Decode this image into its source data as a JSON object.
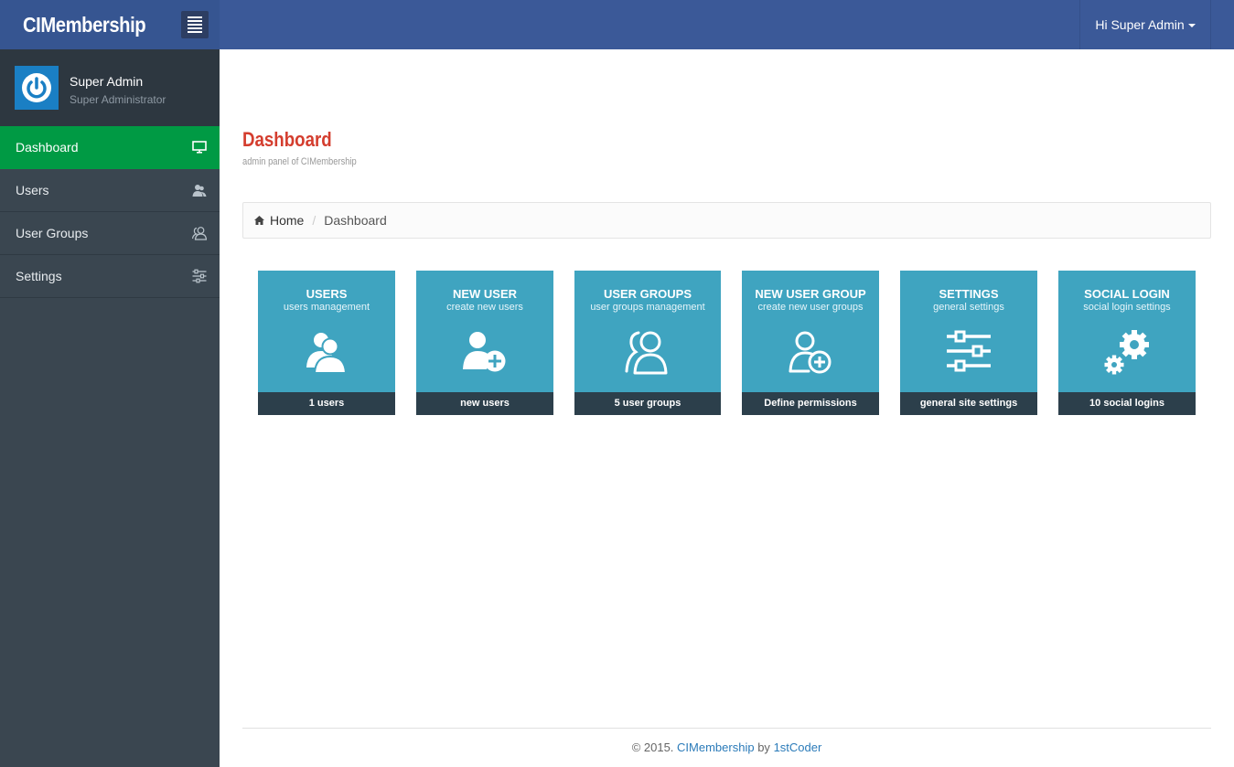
{
  "app": {
    "brand": "CIMembership"
  },
  "header": {
    "user_greeting": "Hi Super Admin"
  },
  "profile": {
    "name": "Super Admin",
    "role": "Super Administrator"
  },
  "sidebar": {
    "items": [
      {
        "label": "Dashboard",
        "icon": "monitor-icon",
        "active": true
      },
      {
        "label": "Users",
        "icon": "user-icon"
      },
      {
        "label": "User Groups",
        "icon": "users-outline-icon"
      },
      {
        "label": "Settings",
        "icon": "sliders-icon"
      }
    ]
  },
  "page": {
    "title": "Dashboard",
    "subtitle": "admin panel of CIMembership"
  },
  "breadcrumb": {
    "home": "Home",
    "current": "Dashboard"
  },
  "tiles": [
    {
      "title": "USERS",
      "desc": "users management",
      "footer": "1 users",
      "icon": "users-icon"
    },
    {
      "title": "NEW USER",
      "desc": "create new users",
      "footer": "new users",
      "icon": "user-add-icon"
    },
    {
      "title": "USER GROUPS",
      "desc": "user groups management",
      "footer": "5 user groups",
      "icon": "user-groups-icon"
    },
    {
      "title": "NEW USER GROUP",
      "desc": "create new user groups",
      "footer": "Define permissions",
      "icon": "group-add-icon"
    },
    {
      "title": "SETTINGS",
      "desc": "general settings",
      "footer": "general site settings",
      "icon": "sliders-icon"
    },
    {
      "title": "SOCIAL LOGIN",
      "desc": "social login settings",
      "footer": "10 social logins",
      "icon": "gears-icon"
    }
  ],
  "footer": {
    "copyright": "© 2015.",
    "product": "CIMembership",
    "by": "by",
    "author": "1stCoder"
  },
  "colors": {
    "topbar": "#3b5998",
    "sidebar": "#3a4650",
    "active": "#009a44",
    "tile": "#3fa4c0",
    "tile_footer": "#2c3f4b",
    "title": "#d43d2e"
  }
}
